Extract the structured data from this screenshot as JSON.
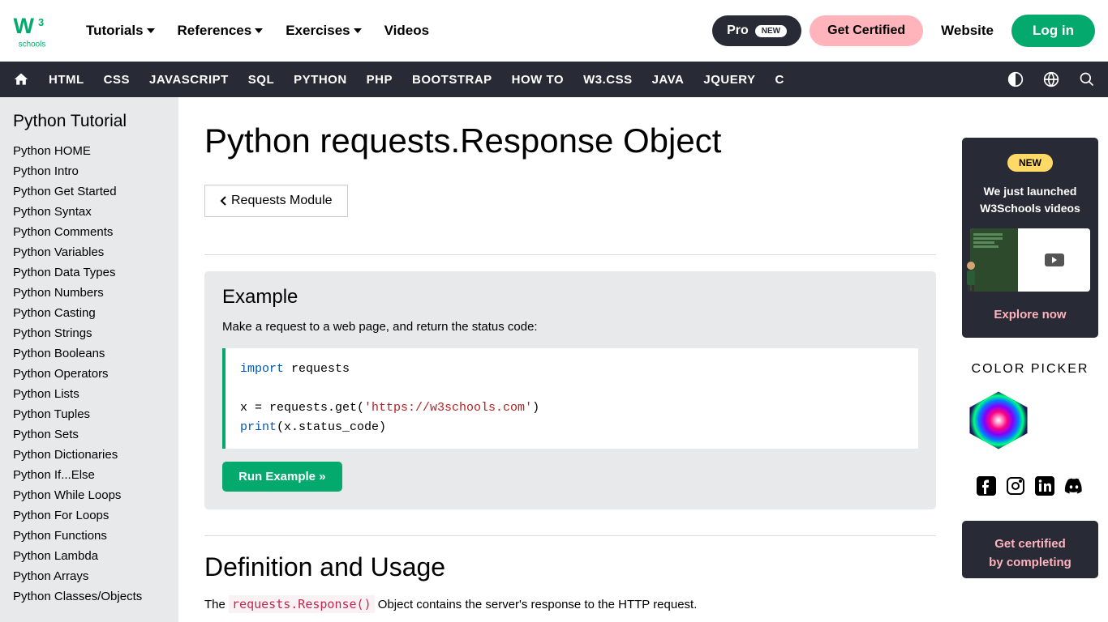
{
  "topnav": {
    "items": [
      "Tutorials",
      "References",
      "Exercises",
      "Videos"
    ],
    "pro": "Pro",
    "pro_badge": "NEW",
    "certified": "Get Certified",
    "website": "Website",
    "login": "Log in"
  },
  "secondnav": {
    "items": [
      "HTML",
      "CSS",
      "JAVASCRIPT",
      "SQL",
      "PYTHON",
      "PHP",
      "BOOTSTRAP",
      "HOW TO",
      "W3.CSS",
      "JAVA",
      "JQUERY",
      "C"
    ]
  },
  "sidebar": {
    "title": "Python Tutorial",
    "links": [
      "Python HOME",
      "Python Intro",
      "Python Get Started",
      "Python Syntax",
      "Python Comments",
      "Python Variables",
      "Python Data Types",
      "Python Numbers",
      "Python Casting",
      "Python Strings",
      "Python Booleans",
      "Python Operators",
      "Python Lists",
      "Python Tuples",
      "Python Sets",
      "Python Dictionaries",
      "Python If...Else",
      "Python While Loops",
      "Python For Loops",
      "Python Functions",
      "Python Lambda",
      "Python Arrays",
      "Python Classes/Objects"
    ]
  },
  "main": {
    "title": "Python requests.Response Object",
    "breadcrumb": "Requests Module",
    "example": {
      "heading": "Example",
      "desc": "Make a request to a web page, and return the status code:",
      "code_import": "import",
      "code_requests": " requests",
      "code_line2a": "x = requests.get(",
      "code_url": "'https://w3schools.com'",
      "code_line2b": ")",
      "code_print": "print",
      "code_line3": "(x.status_code)",
      "run": "Run Example »"
    },
    "definition": {
      "heading": "Definition and Usage",
      "text_pre": "The ",
      "code": "requests.Response()",
      "text_post": " Object contains the server's response to the HTTP request."
    }
  },
  "right": {
    "promo_new": "NEW",
    "promo_line1": "We just launched",
    "promo_line2": "W3Schools videos",
    "promo_link": "Explore now",
    "colorpicker": "COLOR PICKER",
    "cert_line1": "Get certified",
    "cert_line2": "by completing"
  }
}
